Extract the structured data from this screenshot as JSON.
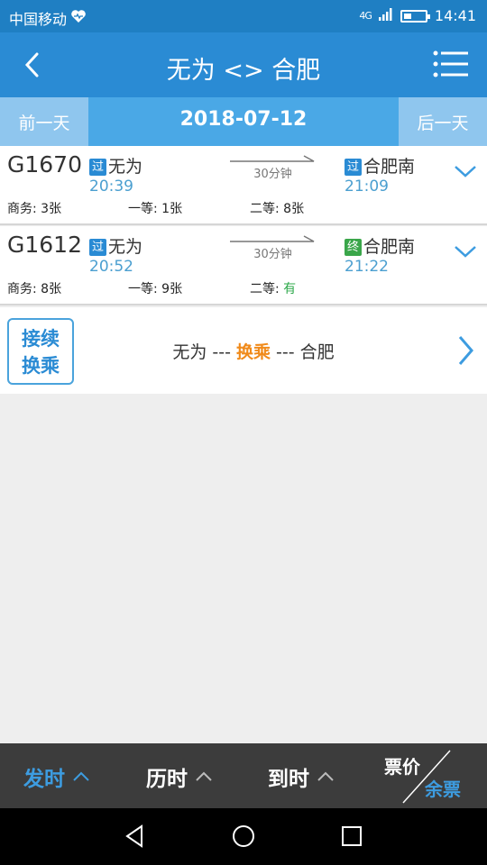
{
  "status": {
    "carrier": "中国移动",
    "net": "4G",
    "time": "14:41"
  },
  "header": {
    "title": "无为 <> 合肥"
  },
  "datebar": {
    "prev": "前一天",
    "date": "2018-07-12",
    "next": "后一天"
  },
  "trains": [
    {
      "no": "G1670",
      "from_badge": "过",
      "from": "无为",
      "dep": "20:39",
      "duration": "30分钟",
      "to_badge": "过",
      "to": "合肥南",
      "arr": "21:09",
      "s1_label": "商务: ",
      "s1_val": "3张",
      "s2_label": "一等: ",
      "s2_val": "1张",
      "s3_label": "二等: ",
      "s3_val": "8张"
    },
    {
      "no": "G1612",
      "from_badge": "过",
      "from": "无为",
      "dep": "20:52",
      "duration": "30分钟",
      "to_badge": "终",
      "to": "合肥南",
      "arr": "21:22",
      "s1_label": "商务: ",
      "s1_val": "8张",
      "s2_label": "一等: ",
      "s2_val": "9张",
      "s3_label": "二等: ",
      "s3_val": "有"
    }
  ],
  "transfer": {
    "badge_line1": "接续",
    "badge_line2": "换乘",
    "from": "无为",
    "sep1": " --- ",
    "mid": "换乘",
    "sep2": " --- ",
    "to": "合肥"
  },
  "bottom": {
    "sort_dep": "发时",
    "sort_dur": "历时",
    "sort_arr": "到时",
    "price": "票价",
    "remain": "余票"
  },
  "colors": {
    "primary": "#2a8bd4",
    "accent": "#f08a1a",
    "available": "#2ca84a"
  }
}
